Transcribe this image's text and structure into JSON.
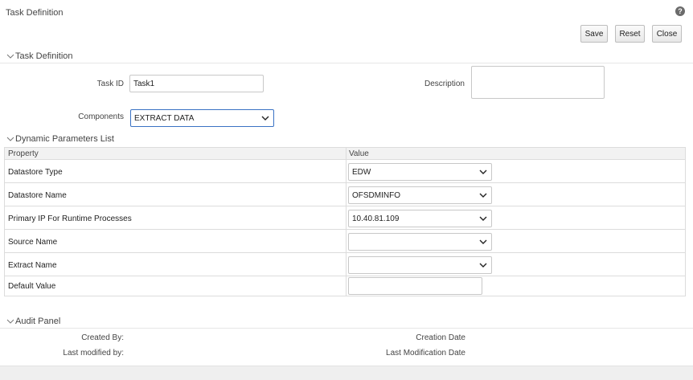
{
  "page": {
    "title": "Task Definition",
    "help_symbol": "?"
  },
  "toolbar": {
    "save_label": "Save",
    "reset_label": "Reset",
    "close_label": "Close"
  },
  "task_section": {
    "title": "Task Definition",
    "task_id_label": "Task ID",
    "task_id_value": "Task1",
    "description_label": "Description",
    "description_value": "",
    "components_label": "Components",
    "components_value": "EXTRACT DATA"
  },
  "params_section": {
    "title": "Dynamic Parameters List",
    "columns": [
      "Property",
      "Value"
    ],
    "rows": [
      {
        "property": "Datastore Type",
        "value": "EDW",
        "kind": "select"
      },
      {
        "property": "Datastore Name",
        "value": "OFSDMINFO",
        "kind": "select"
      },
      {
        "property": "Primary IP For Runtime Processes",
        "value": "10.40.81.109",
        "kind": "select"
      },
      {
        "property": "Source Name",
        "value": "",
        "kind": "select"
      },
      {
        "property": "Extract Name",
        "value": "",
        "kind": "select"
      },
      {
        "property": "Default Value",
        "value": "",
        "kind": "input"
      }
    ]
  },
  "audit_section": {
    "title": "Audit Panel",
    "created_by_label": "Created By:",
    "created_by_value": "",
    "creation_date_label": "Creation Date",
    "creation_date_value": "",
    "last_modified_by_label": "Last modified by:",
    "last_modified_by_value": "",
    "last_modification_date_label": "Last Modification Date",
    "last_modification_date_value": ""
  },
  "icons": {
    "help": "help-icon",
    "section_toggle": "chevron-down-icon",
    "dropdown": "chevron-down-icon"
  }
}
